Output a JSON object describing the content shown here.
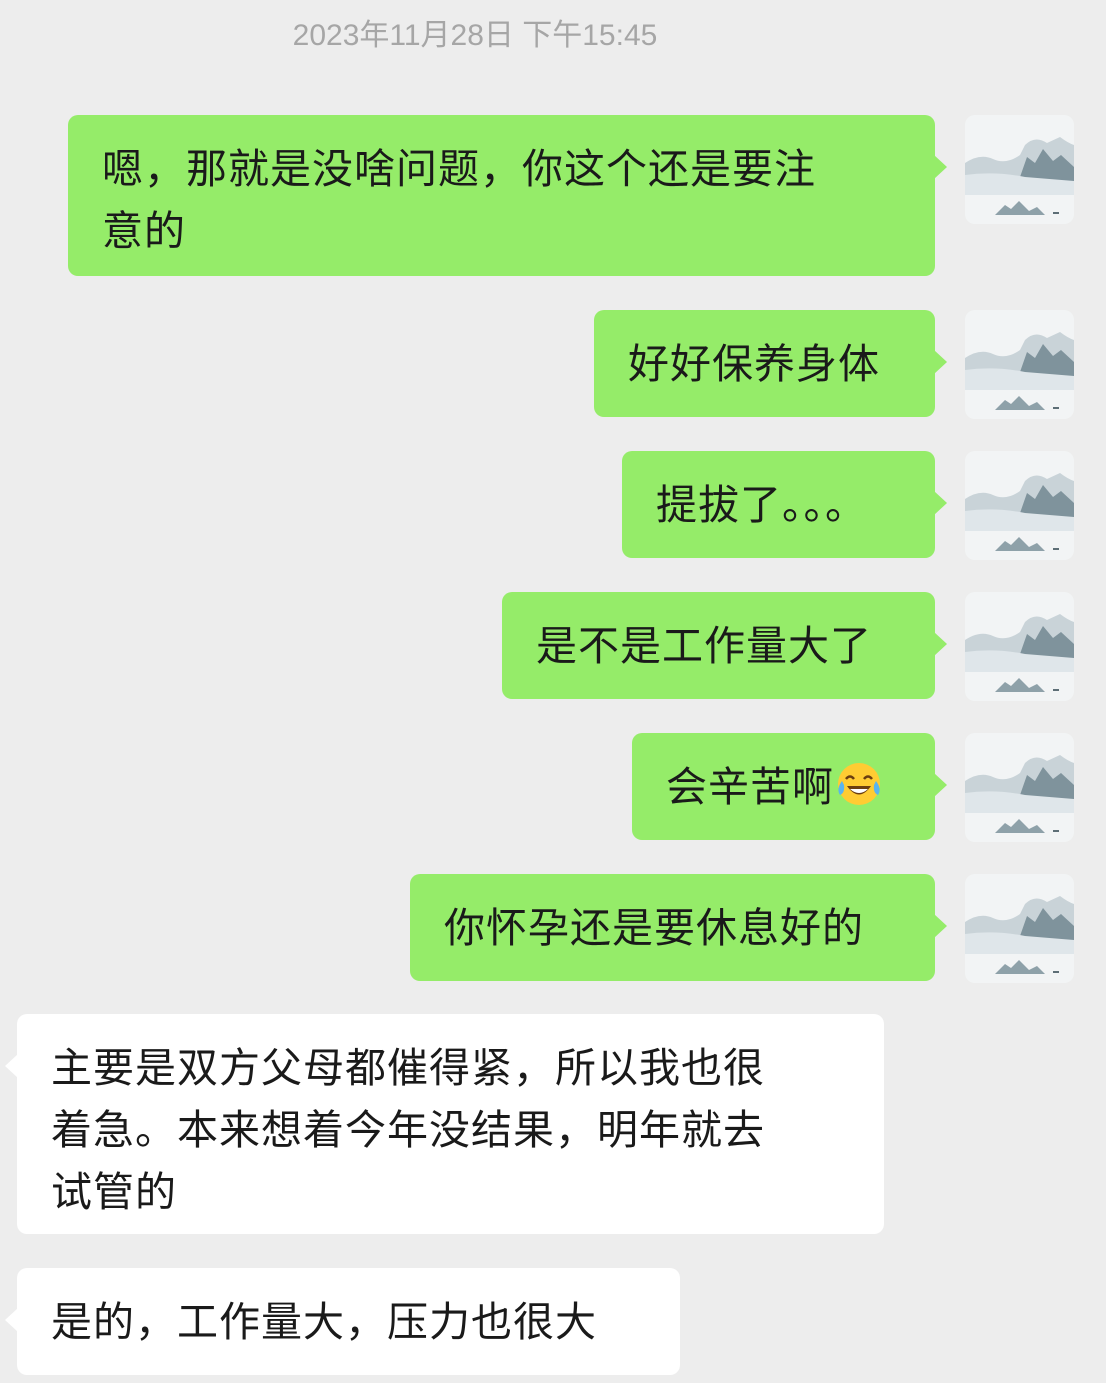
{
  "chat": {
    "timestamp": "2023年11月28日 下午15:45",
    "messages": [
      {
        "side": "out",
        "text": "嗯，那就是没啥问题，你这个还是要注意的",
        "line1": "嗯，那就是没啥问题，你这个还是要注",
        "line2": "意的"
      },
      {
        "side": "out",
        "text": "好好保养身体"
      },
      {
        "side": "out",
        "text": "提拔了。。。"
      },
      {
        "side": "out",
        "text": "是不是工作量大了"
      },
      {
        "side": "out",
        "text": "会辛苦啊",
        "emoji": "face-with-tears-of-joy-icon"
      },
      {
        "side": "out",
        "text": "你怀孕还是要休息好的"
      },
      {
        "side": "in",
        "text": "主要是双方父母都催得紧，所以我也很着急。本来想着今年没结果，明年就去试管的",
        "line1": "主要是双方父母都催得紧，所以我也很",
        "line2": "着急。本来想着今年没结果，明年就去",
        "line3": "试管的"
      },
      {
        "side": "in",
        "text": "是的，工作量大，压力也很大"
      }
    ]
  },
  "colors": {
    "background": "#ededed",
    "outgoing_bubble": "#95ec69",
    "incoming_bubble": "#ffffff",
    "timestamp_text": "#a6a6a6"
  },
  "icons": {
    "avatar": "landscape-avatar-icon",
    "emoji": "face-with-tears-of-joy-icon"
  }
}
